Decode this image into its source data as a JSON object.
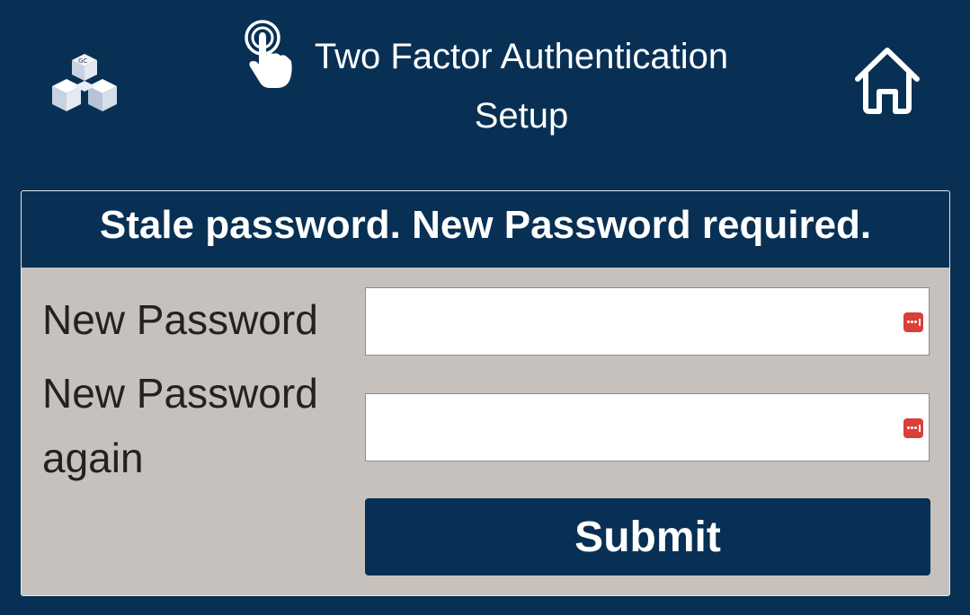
{
  "header": {
    "logo_icon": "cube-logo-icon",
    "touch_icon": "touch-hand-icon",
    "title": "Two Factor Authentication Setup",
    "home_icon": "home-icon"
  },
  "panel": {
    "heading": "Stale password. New Password required.",
    "fields": [
      {
        "label": "New Password",
        "value": "",
        "icon": "password-manager-icon"
      },
      {
        "label": "New Password again",
        "value": "",
        "icon": "password-manager-icon"
      }
    ],
    "submit_label": "Submit"
  },
  "colors": {
    "background": "#083054",
    "panel": "#c6c1bd",
    "button": "#083054",
    "password_icon": "#d9403a"
  }
}
